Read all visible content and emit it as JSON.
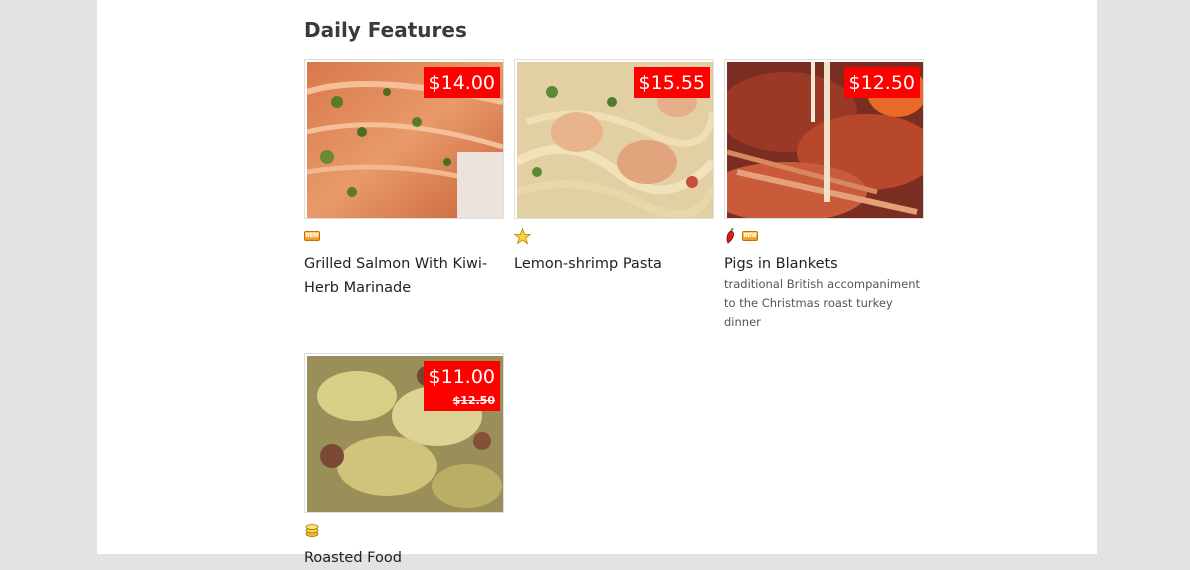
{
  "section": {
    "title": "Daily Features"
  },
  "items": [
    {
      "name": "Grilled Salmon With Kiwi-Herb Marinade",
      "price": "$14.00",
      "icons": [
        "new-badge-icon"
      ]
    },
    {
      "name": "Lemon-shrimp Pasta",
      "price": "$15.55",
      "icons": [
        "star-icon"
      ]
    },
    {
      "name": "Pigs in Blankets",
      "price": "$12.50",
      "description": "traditional British accompaniment to the Christmas roast turkey dinner",
      "icons": [
        "chili-pepper-icon",
        "new-badge-icon"
      ]
    },
    {
      "name": "Roasted Food",
      "price": "$11.00",
      "old_price": "$12.50",
      "icons": [
        "coins-icon"
      ]
    }
  ],
  "colors": {
    "price_tag": "#ff0000",
    "page_bg": "#ffffff",
    "outer_bg": "#e3e3e3"
  }
}
